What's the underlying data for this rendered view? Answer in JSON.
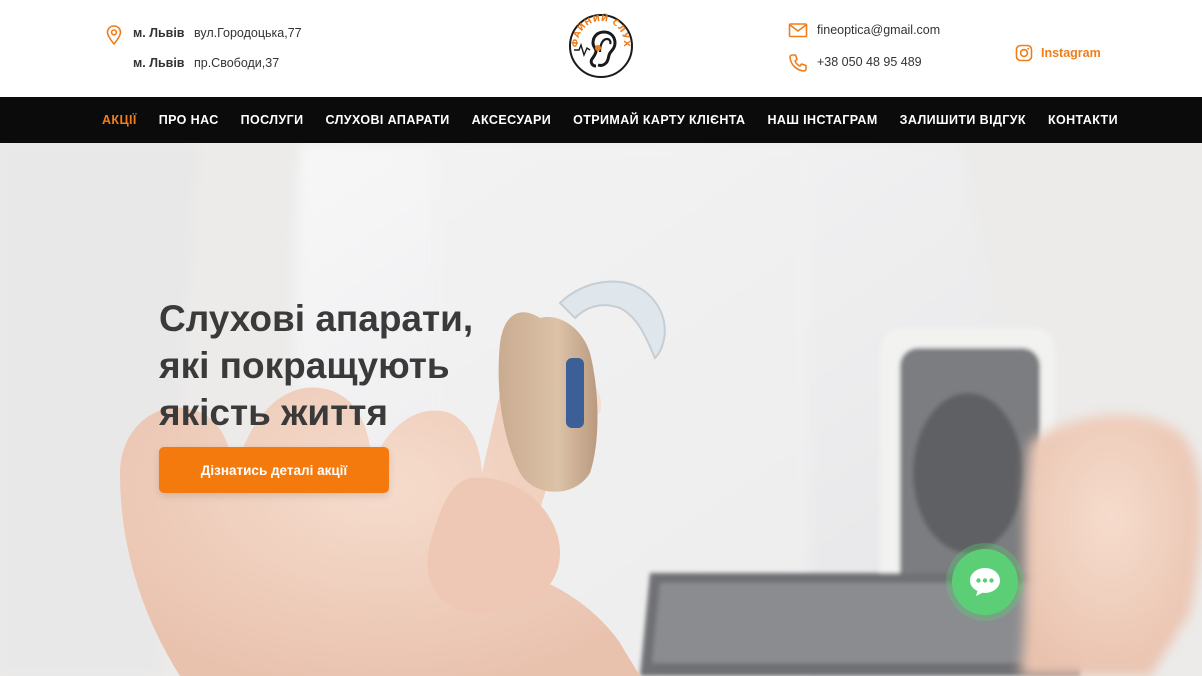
{
  "header": {
    "addresses": [
      {
        "city": "м. Львів",
        "street": "вул.Городоцька,77"
      },
      {
        "city": "м. Львів",
        "street": "пр.Свободи,37"
      }
    ],
    "logo_text": "ФАЙНИЙ СЛУХ",
    "email": "fineoptica@gmail.com",
    "phone": "+38 050 48 95 489",
    "instagram_label": "Instagram"
  },
  "nav": {
    "items": [
      {
        "label": "АКЦІЇ",
        "active": true
      },
      {
        "label": "ПРО НАС",
        "active": false
      },
      {
        "label": "ПОСЛУГИ",
        "active": false
      },
      {
        "label": "СЛУХОВІ АПАРАТИ",
        "active": false
      },
      {
        "label": "АКСЕСУАРИ",
        "active": false
      },
      {
        "label": "ОТРИМАЙ КАРТУ КЛІЄНТА",
        "active": false
      },
      {
        "label": "НАШ ІНСТАГРАМ",
        "active": false
      },
      {
        "label": "ЗАЛИШИТИ ВІДГУК",
        "active": false
      },
      {
        "label": "КОНТАКТИ",
        "active": false
      }
    ]
  },
  "hero": {
    "title_lines": [
      "Слухові апарати,",
      "які покращують",
      "якість життя"
    ],
    "cta_label": "Дізнатись деталі акції"
  },
  "icons": {
    "pin": "map-pin-icon",
    "mail": "mail-icon",
    "phone": "phone-icon",
    "instagram": "instagram-icon",
    "chat": "chat-bubble-icon"
  },
  "colors": {
    "accent": "#f07d1a",
    "nav_bg": "#0b0b0c",
    "cta": "#f57a0e",
    "chat": "#5ccf76"
  }
}
